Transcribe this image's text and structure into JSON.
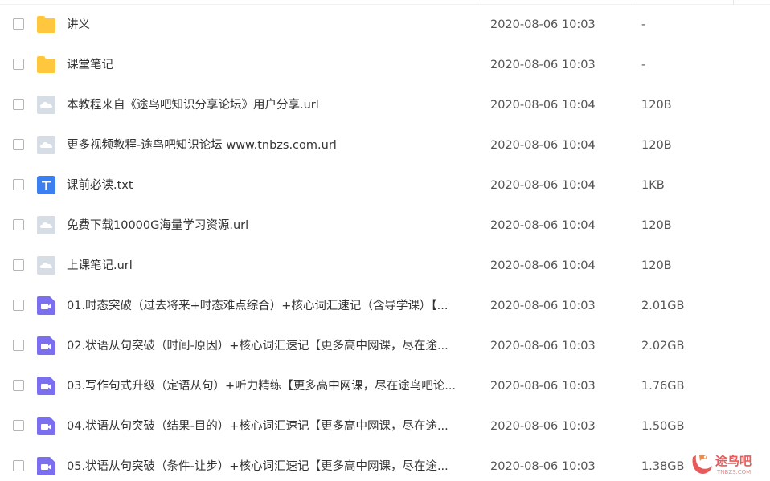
{
  "files": [
    {
      "name": "讲义",
      "date": "2020-08-06 10:03",
      "size": "-",
      "type": "folder"
    },
    {
      "name": "课堂笔记",
      "date": "2020-08-06 10:03",
      "size": "-",
      "type": "folder"
    },
    {
      "name": "本教程来自《途鸟吧知识分享论坛》用户分享.url",
      "date": "2020-08-06 10:04",
      "size": "120B",
      "type": "url"
    },
    {
      "name": "更多视频教程-途鸟吧知识论坛 www.tnbzs.com.url",
      "date": "2020-08-06 10:04",
      "size": "120B",
      "type": "url"
    },
    {
      "name": "课前必读.txt",
      "date": "2020-08-06 10:04",
      "size": "1KB",
      "type": "txt"
    },
    {
      "name": "免费下载10000G海量学习资源.url",
      "date": "2020-08-06 10:04",
      "size": "120B",
      "type": "url"
    },
    {
      "name": "上课笔记.url",
      "date": "2020-08-06 10:04",
      "size": "120B",
      "type": "url"
    },
    {
      "name": "01.时态突破（过去将来+时态难点综合）+核心词汇速记（含导学课）【...",
      "date": "2020-08-06 10:03",
      "size": "2.01GB",
      "type": "video"
    },
    {
      "name": "02.状语从句突破（时间-原因）+核心词汇速记【更多高中网课，尽在途...",
      "date": "2020-08-06 10:03",
      "size": "2.02GB",
      "type": "video"
    },
    {
      "name": "03.写作句式升级（定语从句）+听力精练【更多高中网课，尽在途鸟吧论...",
      "date": "2020-08-06 10:03",
      "size": "1.76GB",
      "type": "video"
    },
    {
      "name": "04.状语从句突破（结果-目的）+核心词汇速记【更多高中网课，尽在途...",
      "date": "2020-08-06 10:03",
      "size": "1.50GB",
      "type": "video"
    },
    {
      "name": "05.状语从句突破（条件-让步）+核心词汇速记【更多高中网课，尽在途...",
      "date": "2020-08-06 10:03",
      "size": "1.38GB",
      "type": "video"
    }
  ],
  "watermark": {
    "text": "途鸟吧",
    "sub": "TNBZS.COM"
  },
  "colors": {
    "folder": "#ffc73d",
    "url": "#d7dde5",
    "txt": "#3c7ff0",
    "video": "#7b6ff0"
  }
}
